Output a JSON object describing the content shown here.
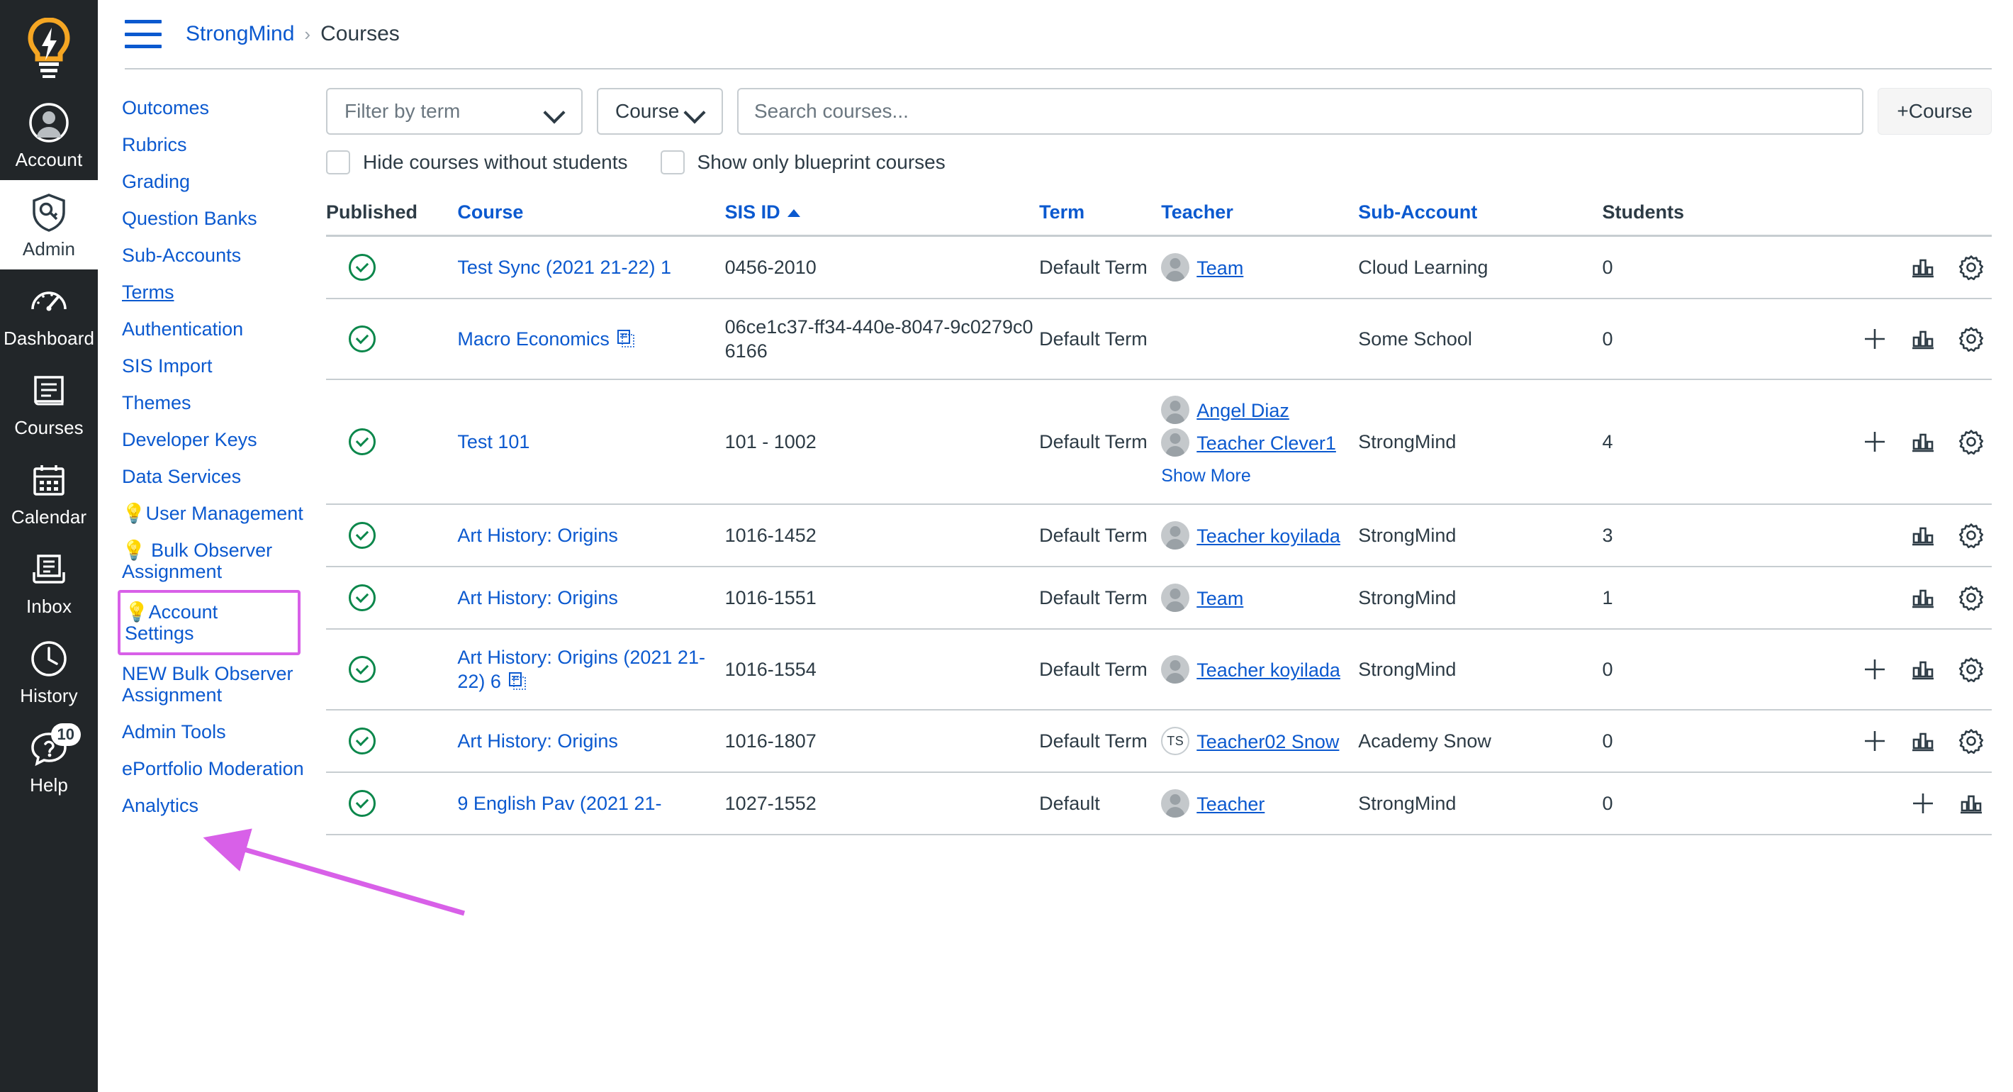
{
  "global_nav": {
    "logo_icon": "lightbulb-logo-icon",
    "items": [
      {
        "label": "Account",
        "icon": "user-circle-icon",
        "active": false
      },
      {
        "label": "Admin",
        "icon": "shield-key-icon",
        "active": true
      },
      {
        "label": "Dashboard",
        "icon": "speedometer-icon",
        "active": false
      },
      {
        "label": "Courses",
        "icon": "book-icon",
        "active": false
      },
      {
        "label": "Calendar",
        "icon": "calendar-icon",
        "active": false
      },
      {
        "label": "Inbox",
        "icon": "inbox-tray-icon",
        "active": false
      },
      {
        "label": "History",
        "icon": "clock-icon",
        "active": false
      },
      {
        "label": "Help",
        "icon": "question-bubble-icon",
        "active": false,
        "badge": "10"
      }
    ]
  },
  "header": {
    "menu_icon": "hamburger-menu-icon",
    "breadcrumb_root": "StrongMind",
    "breadcrumb_sep": "›",
    "breadcrumb_current": "Courses"
  },
  "context_nav": {
    "items": [
      {
        "label": "Outcomes",
        "state": "normal"
      },
      {
        "label": "Rubrics",
        "state": "normal"
      },
      {
        "label": "Grading",
        "state": "normal"
      },
      {
        "label": "Question Banks",
        "state": "normal"
      },
      {
        "label": "Sub-Accounts",
        "state": "normal"
      },
      {
        "label": "Terms",
        "state": "current"
      },
      {
        "label": "Authentication",
        "state": "normal"
      },
      {
        "label": "SIS Import",
        "state": "normal"
      },
      {
        "label": "Themes",
        "state": "normal"
      },
      {
        "label": "Developer Keys",
        "state": "normal"
      },
      {
        "label": "Data Services",
        "state": "normal"
      },
      {
        "label": "💡User Management",
        "state": "normal"
      },
      {
        "label": "💡 Bulk Observer Assignment",
        "state": "normal"
      },
      {
        "label": "💡Account Settings",
        "state": "highlighted"
      },
      {
        "label": "NEW Bulk Observer Assignment",
        "state": "normal"
      },
      {
        "label": "Admin Tools",
        "state": "normal"
      },
      {
        "label": "ePortfolio Moderation",
        "state": "normal"
      },
      {
        "label": "Analytics",
        "state": "normal"
      }
    ]
  },
  "filters": {
    "term_placeholder": "Filter by term",
    "sort_value": "Course",
    "search_placeholder": "Search courses...",
    "add_course_label": "+Course",
    "checkbox_hide_no_students": "Hide courses without students",
    "checkbox_blueprint_only": "Show only blueprint courses"
  },
  "table": {
    "headers": {
      "published": "Published",
      "course": "Course",
      "sis_id": "SIS ID",
      "sort_indicator": "▲",
      "term": "Term",
      "teacher": "Teacher",
      "sub_account": "Sub-Account",
      "students": "Students"
    },
    "rows": [
      {
        "published": true,
        "course": "Test Sync (2021 21-22) 1",
        "blueprint": false,
        "sis_id": "0456-2010",
        "term": "Default Term",
        "teachers": [
          {
            "name": "Team",
            "avatar": "photo"
          }
        ],
        "show_more": false,
        "sub_account": "Cloud Learning",
        "students": "0",
        "actions": [
          "statistics-icon",
          "gear-icon"
        ]
      },
      {
        "published": true,
        "course": "Macro Economics",
        "blueprint": true,
        "sis_id": "06ce1c37-ff34-440e-8047-9c0279c06166",
        "term": "Default Term",
        "teachers": [],
        "show_more": false,
        "sub_account": "Some School",
        "students": "0",
        "actions": [
          "plus-icon",
          "statistics-icon",
          "gear-icon"
        ]
      },
      {
        "published": true,
        "course": "Test 101",
        "blueprint": false,
        "sis_id": "101 - 1002",
        "term": "Default Term",
        "teachers": [
          {
            "name": "Angel Diaz",
            "avatar": "photo"
          },
          {
            "name": "Teacher Clever1",
            "avatar": "photo"
          }
        ],
        "show_more": true,
        "show_more_label": "Show More",
        "sub_account": "StrongMind",
        "students": "4",
        "actions": [
          "plus-icon",
          "statistics-icon",
          "gear-icon"
        ]
      },
      {
        "published": true,
        "course": "Art History: Origins",
        "blueprint": false,
        "sis_id": "1016-1452",
        "term": "Default Term",
        "teachers": [
          {
            "name": "Teacher koyilada",
            "avatar": "photo"
          }
        ],
        "show_more": false,
        "sub_account": "StrongMind",
        "students": "3",
        "actions": [
          "statistics-icon",
          "gear-icon"
        ]
      },
      {
        "published": true,
        "course": "Art History: Origins",
        "blueprint": false,
        "sis_id": "1016-1551",
        "term": "Default Term",
        "teachers": [
          {
            "name": "Team",
            "avatar": "photo"
          }
        ],
        "show_more": false,
        "sub_account": "StrongMind",
        "students": "1",
        "actions": [
          "statistics-icon",
          "gear-icon"
        ]
      },
      {
        "published": true,
        "course": "Art History: Origins (2021 21-22) 6",
        "blueprint": true,
        "sis_id": "1016-1554",
        "term": "Default Term",
        "teachers": [
          {
            "name": "Teacher koyilada",
            "avatar": "photo"
          }
        ],
        "show_more": false,
        "sub_account": "StrongMind",
        "students": "0",
        "actions": [
          "plus-icon",
          "statistics-icon",
          "gear-icon"
        ]
      },
      {
        "published": true,
        "course": "Art History: Origins",
        "blueprint": false,
        "sis_id": "1016-1807",
        "term": "Default Term",
        "teachers": [
          {
            "name": "Teacher02 Snow",
            "avatar": "initials",
            "initials": "TS"
          }
        ],
        "show_more": false,
        "sub_account": "Academy Snow",
        "students": "0",
        "actions": [
          "plus-icon",
          "statistics-icon",
          "gear-icon"
        ]
      },
      {
        "published": true,
        "course": "9 English Pav (2021 21-",
        "blueprint": false,
        "sis_id": "1027-1552",
        "term": "Default",
        "teachers": [
          {
            "name": "Teacher",
            "avatar": "photo"
          }
        ],
        "show_more": false,
        "sub_account": "StrongMind",
        "students": "0",
        "actions": [
          "plus-icon",
          "statistics-icon"
        ]
      }
    ]
  },
  "annotation": {
    "highlight_color": "#d860e8",
    "target_label": "💡Account Settings"
  }
}
